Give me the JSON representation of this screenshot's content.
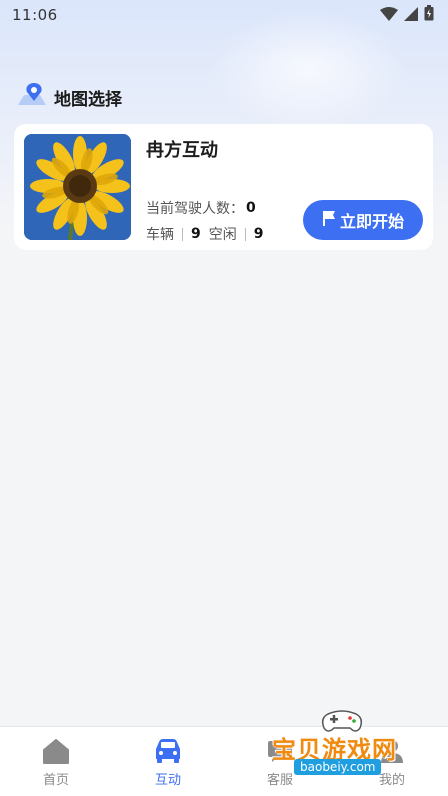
{
  "status": {
    "time": "11:06",
    "icons": [
      "wifi-icon",
      "signal-icon",
      "battery-icon"
    ]
  },
  "section": {
    "title": "地图选择",
    "icon": "map-pin-icon"
  },
  "card": {
    "name": "冉方互动",
    "image": "sunflower-thumbnail",
    "drivers_label": "当前驾驶人数：",
    "drivers_value": "0",
    "vehicles_label": "车辆",
    "vehicles_value": "9",
    "idle_label": "空闲",
    "idle_value": "9",
    "start_button": "立即开始",
    "start_icon": "flag-icon"
  },
  "tabs": [
    {
      "label": "首页",
      "icon": "home-icon",
      "active": false
    },
    {
      "label": "互动",
      "icon": "car-icon",
      "active": true
    },
    {
      "label": "客服",
      "icon": "chat-icon",
      "active": false
    },
    {
      "label": "我的",
      "icon": "user-icon",
      "active": false
    }
  ],
  "watermark": {
    "text": "宝贝游戏网",
    "url": "baobeiy.com"
  },
  "colors": {
    "accent": "#3d6ff2",
    "tab_inactive": "#8a8a8a",
    "background": "#f4f5f7"
  }
}
